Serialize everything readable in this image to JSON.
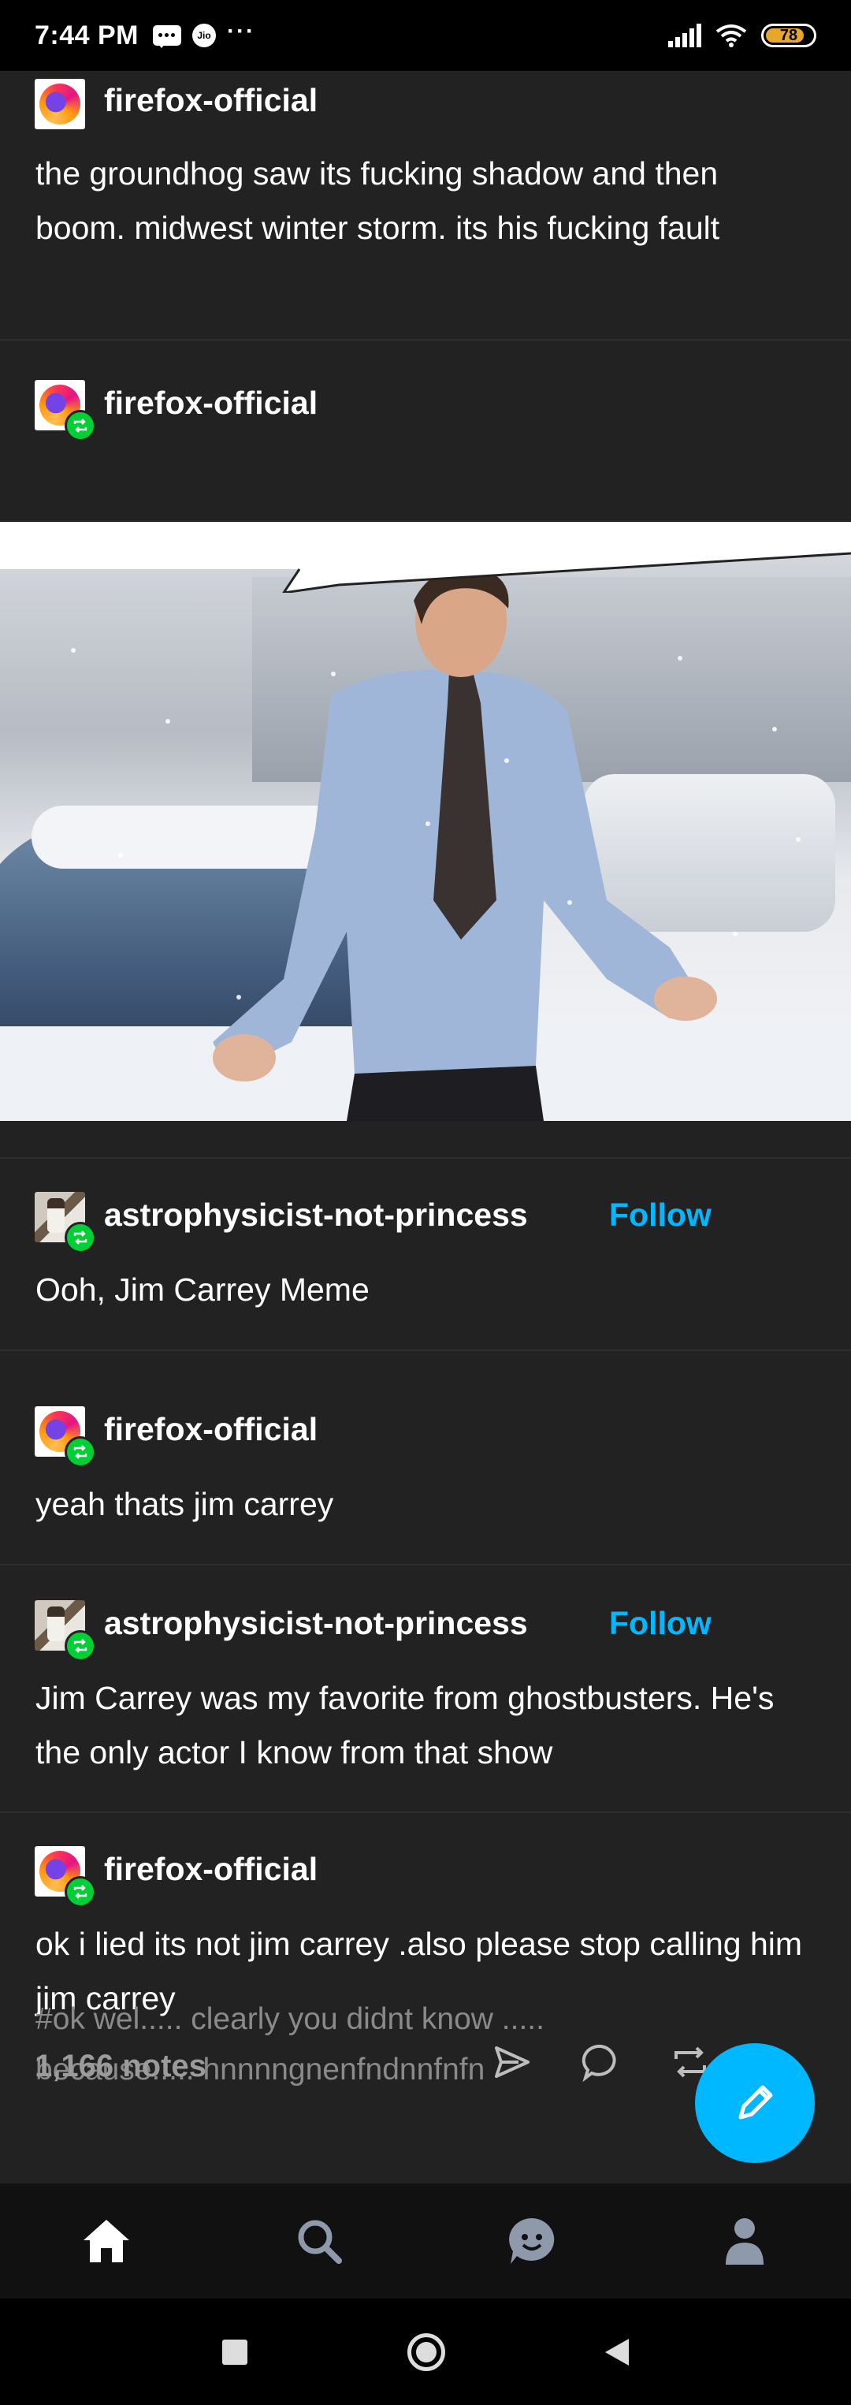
{
  "status_bar": {
    "time": "7:44 PM",
    "battery": "78",
    "jio": "Jio",
    "more": "···"
  },
  "posts": [
    {
      "username": "firefox-official",
      "text": "the groundhog saw its fucking shadow and then boom. midwest winter storm. its his fucking fault"
    },
    {
      "username": "firefox-official"
    },
    {
      "username": "astrophysicist-not-princess",
      "follow": "Follow",
      "text": "Ooh, Jim Carrey Meme"
    },
    {
      "username": "firefox-official",
      "text": "yeah thats jim carrey"
    },
    {
      "username": "astrophysicist-not-princess",
      "follow": "Follow",
      "text": "Jim Carrey was my favorite from ghostbusters. He's the only actor I know from that show"
    },
    {
      "username": "firefox-official",
      "text": "ok i lied its not jim carrey .also please stop calling him jim carrey",
      "tags": "#ok wel..... clearly you didnt know ..... because..... hnnnngnenfndnnfnfn"
    }
  ],
  "footer": {
    "notes": "1,166 notes"
  },
  "icons": {
    "share": "paper-plane-icon",
    "reply": "speech-bubble-icon",
    "reblog": "reblog-icon",
    "compose": "pencil-icon",
    "home": "home-icon",
    "search": "search-icon",
    "activity": "smiley-icon",
    "account": "person-icon",
    "system_recents": "square-icon",
    "system_home": "circle-icon",
    "system_back": "triangle-back-icon"
  },
  "colors": {
    "accent": "#00b8ff",
    "reblog_green": "#00cf35",
    "background": "#222222"
  }
}
